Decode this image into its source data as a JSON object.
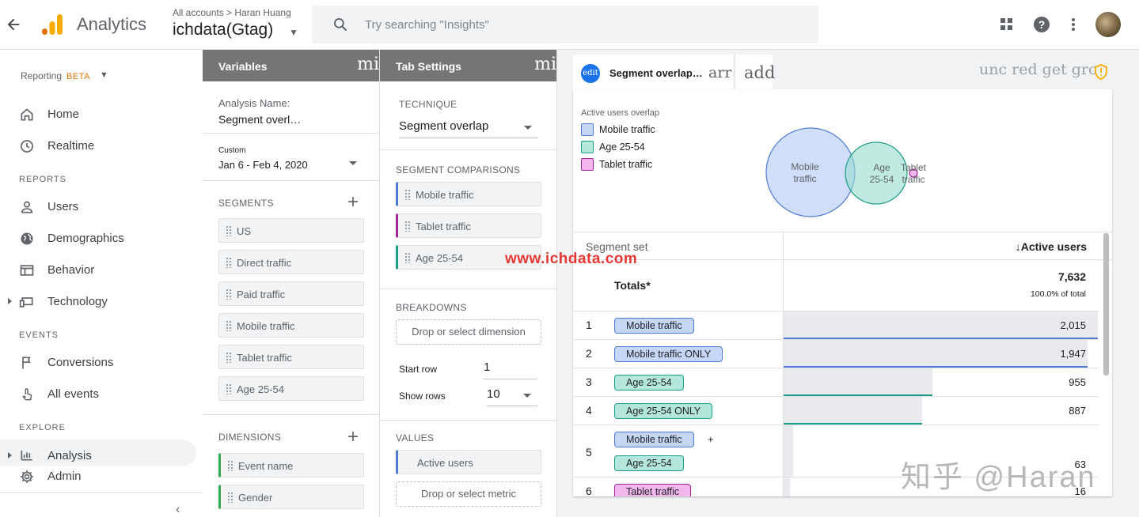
{
  "header": {
    "app_title": "Analytics",
    "breadcrumb": "All accounts > Haran Huang",
    "property": "ichdata(Gtag)",
    "search_placeholder": "Try searching \"Insights\"",
    "colors": {
      "logo_orange": "#f9ab00",
      "logo_dark": "#e37400"
    }
  },
  "sidebar": {
    "reporting_label": "Reporting",
    "beta": "BETA",
    "items": [
      {
        "label": "Home",
        "icon": "home-icon"
      },
      {
        "label": "Realtime",
        "icon": "clock-icon"
      },
      {
        "label": "Users",
        "icon": "person-icon"
      },
      {
        "label": "Demographics",
        "icon": "globe-icon"
      },
      {
        "label": "Behavior",
        "icon": "web-icon"
      },
      {
        "label": "Technology",
        "icon": "devices-icon"
      },
      {
        "label": "Conversions",
        "icon": "flag-icon"
      },
      {
        "label": "All events",
        "icon": "touch-icon"
      },
      {
        "label": "Analysis",
        "icon": "analysis-icon"
      },
      {
        "label": "Admin",
        "icon": "gear-icon"
      }
    ],
    "sections": {
      "reports": "REPORTS",
      "events": "EVENTS",
      "explore": "EXPLORE"
    },
    "collapse_glyph": "‹"
  },
  "variables": {
    "title": "Variables",
    "mini": "mi",
    "analysis_name_label": "Analysis Name:",
    "analysis_name_value": "Segment overl…",
    "date_label": "Custom",
    "date_value": "Jan 6 - Feb 4, 2020",
    "segments_title": "SEGMENTS",
    "segments": [
      "US",
      "Direct traffic",
      "Paid traffic",
      "Mobile traffic",
      "Tablet traffic",
      "Age 25-54"
    ],
    "dimensions_title": "DIMENSIONS",
    "dimensions": [
      "Event name",
      "Gender"
    ]
  },
  "tab_settings": {
    "title": "Tab Settings",
    "mini": "mi",
    "technique_label": "TECHNIQUE",
    "technique_value": "Segment overlap",
    "comparisons_label": "SEGMENT COMPARISONS",
    "comparisons": [
      {
        "label": "Mobile traffic",
        "color": "#4f7bd6"
      },
      {
        "label": "Tablet traffic",
        "color": "#a3289a"
      },
      {
        "label": "Age 25-54",
        "color": "#1a9e86"
      }
    ],
    "breakdowns_label": "BREAKDOWNS",
    "breakdown_drop": "Drop or select dimension",
    "start_row_label": "Start row",
    "start_row_value": "1",
    "show_rows_label": "Show rows",
    "show_rows_value": "10",
    "values_label": "VALUES",
    "value_metric": "Active users",
    "metric_drop": "Drop or select metric"
  },
  "canvas": {
    "tab_edit": "edit",
    "tab_label": "Segment overlap…",
    "tab_arr": "arr",
    "tab_add": "add",
    "toolbar_text": "unc red get grc",
    "chart_title": "Active users overlap",
    "legend": [
      {
        "label": "Mobile traffic",
        "fill": "#c5d6f7",
        "stroke": "#4f7bd6"
      },
      {
        "label": "Age 25-54",
        "fill": "#b4e6dc",
        "stroke": "#1a9e86"
      },
      {
        "label": "Tablet traffic",
        "fill": "#f2b8ee",
        "stroke": "#a3289a"
      }
    ],
    "venn_labels": {
      "mobile_1": "Mobile",
      "mobile_2": "traffic",
      "age_1": "Age",
      "age_2": "25-54",
      "tablet_1": "Tablet",
      "tablet_2": "traffic"
    },
    "table": {
      "col1": "Segment set",
      "col2": "↓Active users",
      "totals_label": "Totals*",
      "totals_value": "7,632",
      "totals_sub": "100.0% of total",
      "rows": [
        {
          "n": "1",
          "segments": [
            "Mobile traffic"
          ],
          "value": "2,015",
          "ratio": 1.0,
          "color": "#4f7bd6"
        },
        {
          "n": "2",
          "segments": [
            "Mobile traffic ONLY"
          ],
          "value": "1,947",
          "ratio": 0.966,
          "color": "#4f7bd6"
        },
        {
          "n": "3",
          "segments": [
            "Age 25-54"
          ],
          "value": "955",
          "ratio": 0.474,
          "color": "#1a9e86"
        },
        {
          "n": "4",
          "segments": [
            "Age 25-54 ONLY"
          ],
          "value": "887",
          "ratio": 0.44,
          "color": "#1a9e86"
        },
        {
          "n": "5",
          "segments": [
            "Mobile traffic",
            "Age 25-54"
          ],
          "plus": "+",
          "value": "63",
          "ratio": 0.031
        },
        {
          "n": "6",
          "segments": [
            "Tablet traffic"
          ],
          "value": "16",
          "ratio": 0.008
        }
      ]
    }
  },
  "watermarks": {
    "site": "www.ichdata.com",
    "zhihu": "知乎 @Haran"
  }
}
